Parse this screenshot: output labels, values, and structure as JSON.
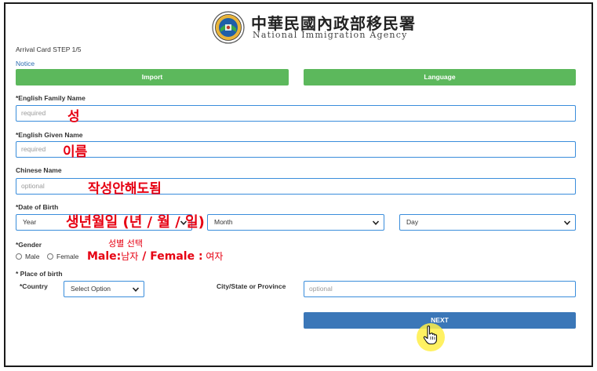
{
  "header": {
    "agency_cn": "中華民國內政部移民署",
    "agency_en": "National Immigration Agency",
    "seal_icon": "agency-seal-icon"
  },
  "step_title": "Arrival Card STEP 1/5",
  "notice_link": "Notice",
  "buttons": {
    "import": "Import",
    "language": "Language",
    "next": "NEXT"
  },
  "fields": {
    "family_name": {
      "label": "*English Family Name",
      "placeholder": "required"
    },
    "given_name": {
      "label": "*English Given Name",
      "placeholder": "required"
    },
    "chinese_name": {
      "label": "Chinese Name",
      "placeholder": "optional"
    },
    "dob": {
      "label": "*Date of Birth",
      "year": "Year",
      "month": "Month",
      "day": "Day"
    },
    "gender": {
      "label": "*Gender",
      "male": "Male",
      "female": "Female"
    },
    "place_of_birth": {
      "label": "* Place of birth",
      "country_label": "*Country",
      "country_value": "Select Option",
      "city_label": "City/State or Province",
      "city_placeholder": "optional"
    }
  },
  "annotations": {
    "family_name": "성",
    "given_name": "이름",
    "chinese_name": "작성안해도됨",
    "dob": "생년월일 (년 / 월 / 일)",
    "gender_title": "성별 선택",
    "gender_male_en": "Male:",
    "gender_male_ko": "남자",
    "gender_sep": " / ",
    "gender_female_en": "Female :",
    "gender_female_ko": " 여자"
  },
  "colors": {
    "green": "#5cb85c",
    "blue": "#3b77b8",
    "input_border": "#3a8ddb",
    "annotation_red": "#e60012",
    "cursor_halo": "#ffee46"
  }
}
